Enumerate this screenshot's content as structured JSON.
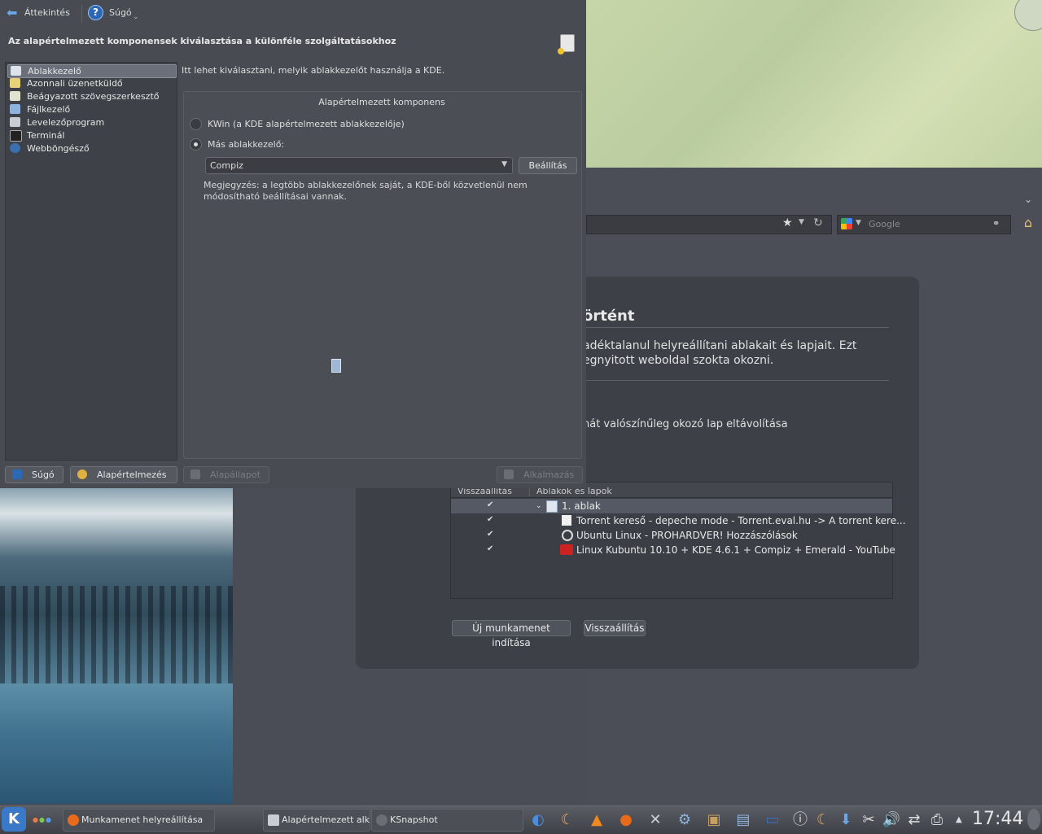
{
  "toolbar": {
    "back_label": "Áttekintés",
    "help_label": "Súgó"
  },
  "settings": {
    "heading": "Az alapértelmezett komponensek kiválasztása a különféle szolgáltatásokhoz",
    "sidebar": [
      {
        "label": "Ablakkezelő",
        "icon": "window-manager-icon",
        "selected": true
      },
      {
        "label": "Azonnali üzenetküldő",
        "icon": "instant-messenger-icon"
      },
      {
        "label": "Beágyazott szövegszerkesztő",
        "icon": "text-editor-icon"
      },
      {
        "label": "Fájlkezelő",
        "icon": "file-manager-icon"
      },
      {
        "label": "Levelezőprogram",
        "icon": "mail-client-icon"
      },
      {
        "label": "Terminál",
        "icon": "terminal-icon"
      },
      {
        "label": "Webböngésző",
        "icon": "web-browser-icon"
      }
    ],
    "intro": "Itt lehet kiválasztani, melyik ablakkezelőt használja a KDE.",
    "group_title": "Alapértelmezett komponens",
    "radio_kwin": "KWin (a KDE alapértelmezett ablakkezelője)",
    "radio_other": "Más ablakkezelő:",
    "combo_value": "Compiz",
    "settings_button": "Beállítás",
    "note": "Megjegyzés: a legtöbb ablakkezelőnek saját, a KDE-ből közvetlenül nem módosítható beállításai vannak.",
    "buttons": {
      "help": "Súgó",
      "defaults": "Alapértelmezés",
      "reset": "Alapállapot",
      "apply": "Alkalmazás"
    }
  },
  "browser": {
    "search_placeholder": "Google",
    "restore": {
      "title": "örtént",
      "desc": "adéktalanul helyreállítani ablakait és lapjait. Ezt egnyitott weboldal szokta okozni.",
      "remove_text": "nát valószínűleg okozó lap eltávolítása",
      "col_restore": "Visszaállítás",
      "col_windows": "Ablakok és lapok",
      "rows": [
        {
          "label": "1. ablak",
          "checked": true
        },
        {
          "label": "Torrent kereső - depeche mode - Torrent.eval.hu -> A torrent kere...",
          "checked": true
        },
        {
          "label": "Ubuntu Linux - PROHARDVER! Hozzászólások",
          "checked": true
        },
        {
          "label": "Linux Kubuntu 10.10 + KDE 4.6.1 + Compiz + Emerald - YouTube",
          "checked": true
        }
      ],
      "new_session": "Új munkamenet indítása",
      "restore_btn": "Visszaállítás"
    }
  },
  "taskbar": {
    "tasks": [
      "Munkamenet helyreállítása",
      "Alapértelmezett alkalmazások",
      "KSnapshot"
    ],
    "clock": "17:44"
  }
}
